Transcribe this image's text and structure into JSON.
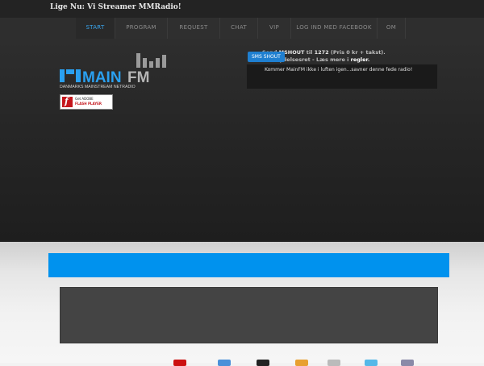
{
  "header": {
    "now_playing": "Lige Nu: Vi Streamer MMRadio!"
  },
  "nav": {
    "items": [
      {
        "label": "START",
        "active": true
      },
      {
        "label": "PROGRAM"
      },
      {
        "label": "REQUEST"
      },
      {
        "label": "CHAT"
      },
      {
        "label": "VIP"
      },
      {
        "label": "LOG IND MED FACEBOOK"
      },
      {
        "label": "OM"
      }
    ]
  },
  "logo": {
    "name_main": "MAIN",
    "name_fm": "FM",
    "tagline": "DANMARKS MAINSTREAM NETRADIO"
  },
  "flash_badge": {
    "line1": "Get ADOBE",
    "line2": "FLASH PLAYER"
  },
  "sms": {
    "tab_label": "SMS SHOUT",
    "line1_pre": "Send ",
    "line1_keyword": "MSHOUT",
    "line1_mid": " til ",
    "line1_number": "1272",
    "line1_post": " (Pris 0 kr + takst).",
    "line2_pre": "...ortrydelsesret - L",
    "line2_mid": "æs mere i ",
    "line2_link": "regler."
  },
  "shoutbox": {
    "message": "Kommer MainFM ikke i luften igen...savner denne fede radio!"
  },
  "colors": {
    "accent_blue": "#0092ee",
    "nav_active": "#39a5ee",
    "flash_red": "#c4161c"
  }
}
